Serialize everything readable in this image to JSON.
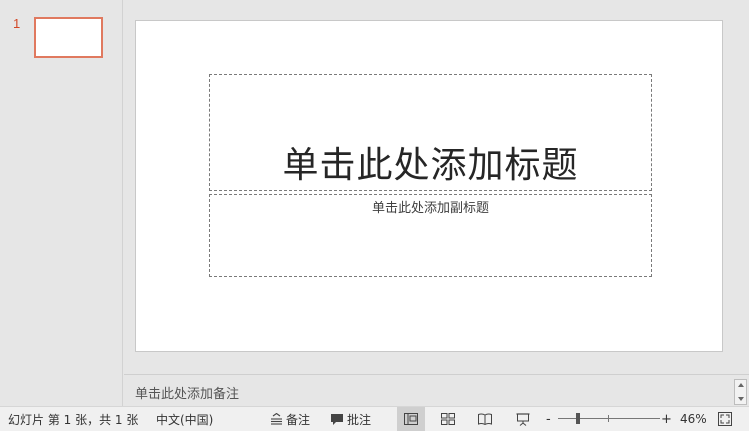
{
  "thumbnails": [
    {
      "number": "1"
    }
  ],
  "slide": {
    "title_placeholder": "单击此处添加标题",
    "subtitle_placeholder": "单击此处添加副标题"
  },
  "notes": {
    "placeholder": "单击此处添加备注"
  },
  "status_bar": {
    "slide_count": "幻灯片 第 1 张，共 1 张",
    "language": "中文(中国)",
    "notes_label": "备注",
    "comments_label": "批注",
    "zoom_percent": "46%",
    "zoom_minus": "-",
    "zoom_plus": "+",
    "zoom_value": 46
  },
  "icons": {
    "notes": "notes-icon",
    "comments": "comment-icon",
    "normal_view": "normal-view-icon",
    "sorter_view": "slide-sorter-icon",
    "reading_view": "reading-view-icon",
    "slideshow": "slideshow-icon",
    "fit": "fit-to-window-icon"
  },
  "colors": {
    "accent": "#d24726",
    "thumb_border": "#e0795f"
  }
}
